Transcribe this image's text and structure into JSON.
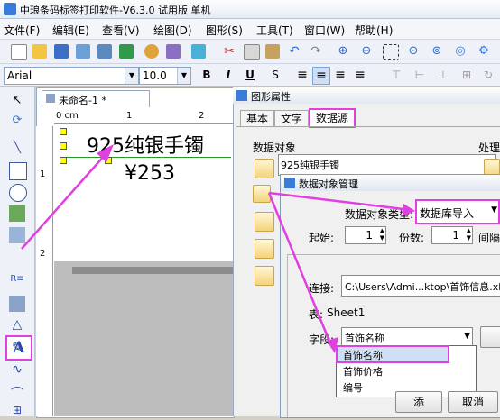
{
  "window": {
    "title": "中琅条码标签打印软件-V6.3.0 试用版 单机"
  },
  "menu": [
    "文件(F)",
    "编辑(E)",
    "查看(V)",
    "绘图(D)",
    "图形(S)",
    "工具(T)",
    "窗口(W)",
    "帮助(H)"
  ],
  "format_bar": {
    "font": "Arial",
    "size": "10.0",
    "bold": "B",
    "italic": "I",
    "underline": "U"
  },
  "document": {
    "tab_label": "未命名-1 *",
    "ruler_unit": "0 cm",
    "ruler_ticks": [
      "1",
      "2"
    ],
    "vruler_ticks": [
      "1",
      "2"
    ],
    "label_text": "925纯银手镯",
    "price_text": "¥253"
  },
  "properties_panel": {
    "title": "图形属性",
    "tabs": [
      "基本",
      "文字",
      "数据源"
    ],
    "data_object_label": "数据对象",
    "process_label": "处理",
    "data_object_item": "925纯银手镯"
  },
  "dialog": {
    "title": "数据对象管理",
    "type_label": "数据对象类型:",
    "type_value": "数据库导入",
    "start_label": "起始:",
    "start_value": "1",
    "copies_label": "份数:",
    "copies_value": "1",
    "interval_label": "间隔",
    "connection_label": "连接:",
    "connection_value": "C:\\Users\\Admi...ktop\\首饰信息.xls",
    "table_label": "表:",
    "table_value": "Sheet1",
    "field_label": "字段:",
    "field_value": "首饰名称",
    "field_options": [
      "首饰名称",
      "首饰价格",
      "编号"
    ],
    "button_ok": "添",
    "button_cancel": "取消"
  },
  "colors": {
    "highlight": "#e040e0",
    "accent": "#3a7ad8"
  }
}
